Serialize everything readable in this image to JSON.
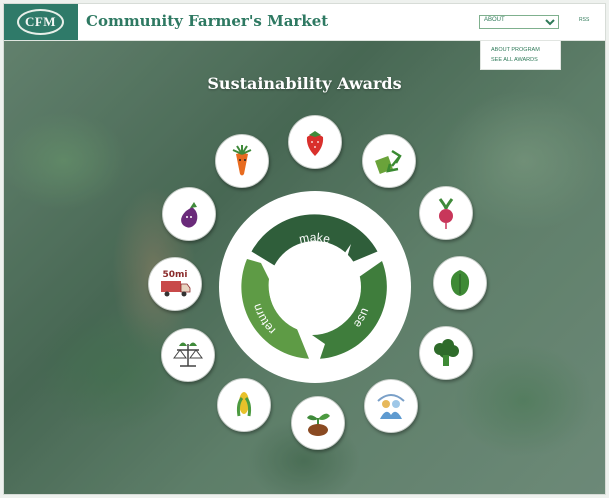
{
  "header": {
    "logo_text": "CFM",
    "site_title": "Community Farmer's Market",
    "nav_select": {
      "value": "ABOUT"
    },
    "rss_label": "RSS"
  },
  "dropdown": {
    "items": [
      {
        "label": "ABOUT PROGRAM"
      },
      {
        "label": "SEE ALL AWARDS"
      }
    ]
  },
  "hero": {
    "title": "Sustainability Awards"
  },
  "cycle": {
    "segments": [
      {
        "label": "make",
        "color": "#2f5e3a"
      },
      {
        "label": "use",
        "color": "#3f7d3c"
      },
      {
        "label": "return",
        "color": "#5e9b45"
      }
    ]
  },
  "award_icons": [
    {
      "name": "carrot-icon"
    },
    {
      "name": "strawberry-icon"
    },
    {
      "name": "recycle-icon"
    },
    {
      "name": "radish-icon"
    },
    {
      "name": "lettuce-icon"
    },
    {
      "name": "broccoli-icon"
    },
    {
      "name": "community-icon"
    },
    {
      "name": "seedling-icon"
    },
    {
      "name": "corn-icon"
    },
    {
      "name": "scales-icon"
    },
    {
      "name": "truck-50mi-icon",
      "badge_text": "50mi"
    },
    {
      "name": "eggplant-icon"
    }
  ],
  "colors": {
    "brand_green": "#2f7a69",
    "title_green": "#2e7962",
    "link_green": "#2f7a59"
  }
}
